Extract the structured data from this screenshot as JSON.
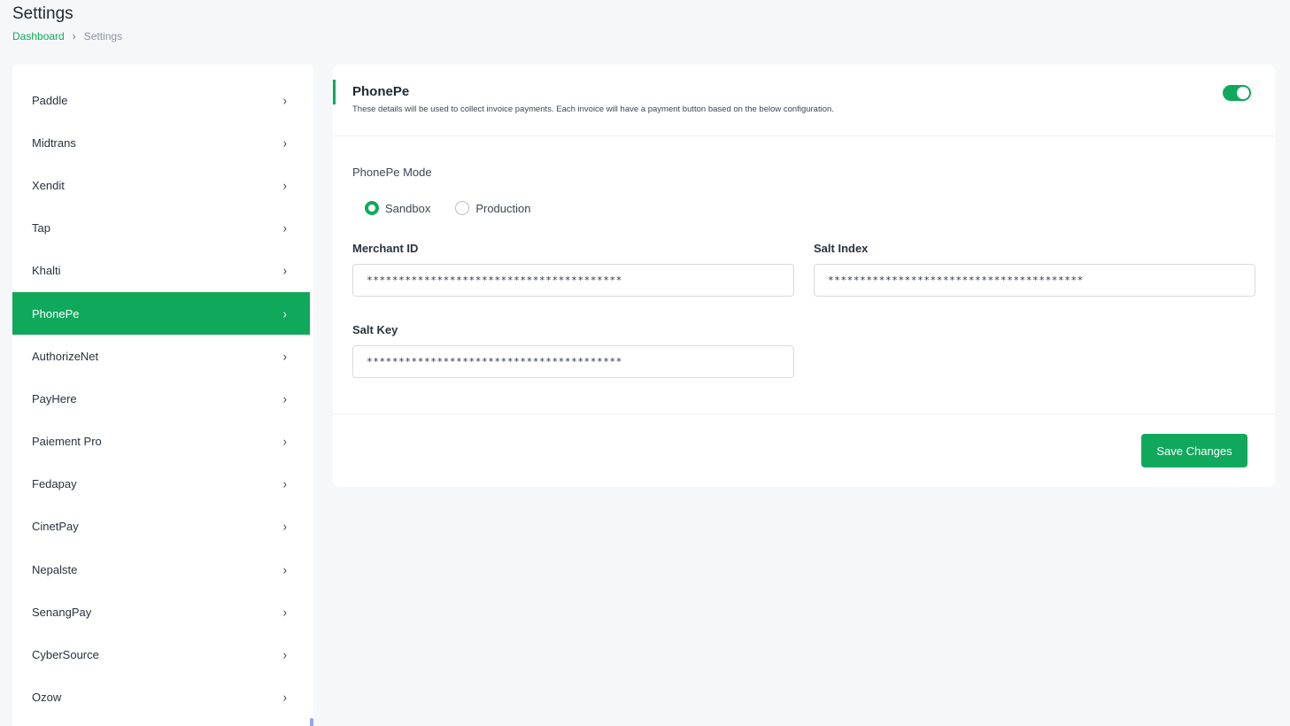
{
  "header": {
    "title": "Settings",
    "breadcrumb": {
      "home": "Dashboard",
      "separator": "›",
      "current": "Settings"
    }
  },
  "sidebar": {
    "items": [
      {
        "label": "Paddle",
        "active": false
      },
      {
        "label": "Midtrans",
        "active": false
      },
      {
        "label": "Xendit",
        "active": false
      },
      {
        "label": "Tap",
        "active": false
      },
      {
        "label": "Khalti",
        "active": false
      },
      {
        "label": "PhonePe",
        "active": true
      },
      {
        "label": "AuthorizeNet",
        "active": false
      },
      {
        "label": "PayHere",
        "active": false
      },
      {
        "label": "Paiement Pro",
        "active": false
      },
      {
        "label": "Fedapay",
        "active": false
      },
      {
        "label": "CinetPay",
        "active": false
      },
      {
        "label": "Nepalste",
        "active": false
      },
      {
        "label": "SenangPay",
        "active": false
      },
      {
        "label": "CyberSource",
        "active": false
      },
      {
        "label": "Ozow",
        "active": false
      }
    ],
    "chevron": "›"
  },
  "card": {
    "title": "PhonePe",
    "description": "These details will be used to collect invoice payments. Each invoice will have a payment button based on the below configuration.",
    "enabled": true,
    "mode_label": "PhonePe Mode",
    "modes": [
      {
        "label": "Sandbox",
        "checked": true
      },
      {
        "label": "Production",
        "checked": false
      }
    ],
    "fields": {
      "merchant_id": {
        "label": "Merchant ID",
        "value": "****************************************"
      },
      "salt_index": {
        "label": "Salt Index",
        "value": "****************************************"
      },
      "salt_key": {
        "label": "Salt Key",
        "value": "****************************************"
      }
    },
    "save_label": "Save Changes"
  },
  "colors": {
    "accent": "#10a95c",
    "background": "#f6f7f9"
  }
}
